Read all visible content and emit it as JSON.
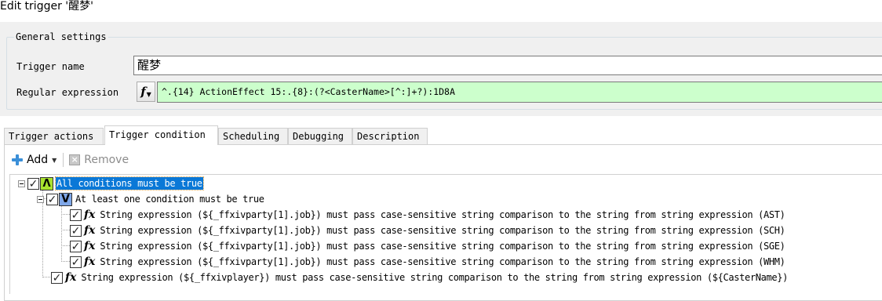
{
  "window": {
    "title": "Edit trigger '醒梦'"
  },
  "general": {
    "legend": "General settings",
    "name_label": "Trigger name",
    "name_value": "醒梦",
    "regex_label": "Regular expression",
    "regex_value": "^.{14} ActionEffect 15:.{8}:(?<CasterName>[^:]+?):1D8A"
  },
  "tabs": [
    {
      "label": "Trigger actions",
      "active": false
    },
    {
      "label": "Trigger condition",
      "active": true
    },
    {
      "label": "Scheduling",
      "active": false
    },
    {
      "label": "Debugging",
      "active": false
    },
    {
      "label": "Description",
      "active": false
    }
  ],
  "toolbar": {
    "add_label": "Add",
    "remove_label": "Remove"
  },
  "tree": {
    "root_label": "All conditions must be true",
    "group_label": "At least one condition must be true",
    "conditions": [
      "String expression (${_ffxivparty[1].job}) must pass case-sensitive string comparison to the string from string expression (AST)",
      "String expression (${_ffxivparty[1].job}) must pass case-sensitive string comparison to the string from string expression (SCH)",
      "String expression (${_ffxivparty[1].job}) must pass case-sensitive string comparison to the string from string expression (SGE)",
      "String expression (${_ffxivparty[1].job}) must pass case-sensitive string comparison to the string from string expression (WHM)"
    ],
    "last_condition": "String expression (${_ffxivplayer}) must pass case-sensitive string comparison to the string from string expression (${CasterName})",
    "and_symbol": "Λ",
    "or_symbol": "V"
  },
  "colors": {
    "regex_bg": "#ccffcc",
    "and_badge": "#a8e22f",
    "or_badge": "#7fa7e8",
    "selection": "#0a78d7"
  }
}
